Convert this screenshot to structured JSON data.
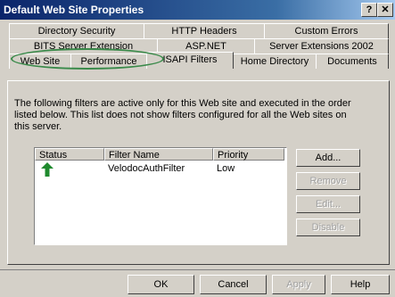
{
  "window": {
    "title": "Default Web Site Properties",
    "help_glyph": "?",
    "close_glyph": "✕"
  },
  "tabs": {
    "row1": [
      "Directory Security",
      "HTTP Headers",
      "Custom Errors"
    ],
    "row2": [
      "BITS Server Extension",
      "ASP.NET",
      "Server Extensions 2002"
    ],
    "row3": [
      "Web Site",
      "Performance",
      "ISAPI Filters",
      "Home Directory",
      "Documents"
    ],
    "active": "ISAPI Filters"
  },
  "description": "The following filters are active only for this Web site and executed in the order listed below. This list does not show filters configured for all the Web sites on this server.",
  "filters": {
    "columns": [
      "Status",
      "Filter Name",
      "Priority"
    ],
    "rows": [
      {
        "status_icon": "green-up-arrow-icon",
        "name": "VelodocAuthFilter",
        "priority": "Low"
      }
    ]
  },
  "side_buttons": [
    "Add...",
    "Remove",
    "Edit...",
    "Disable"
  ],
  "bottom_buttons": [
    "OK",
    "Cancel",
    "Apply",
    "Help"
  ],
  "colors": {
    "title_bar": "#0a246a",
    "highlight_ellipse": "#3a8a4a",
    "status_arrow": "#1f8a2e"
  }
}
